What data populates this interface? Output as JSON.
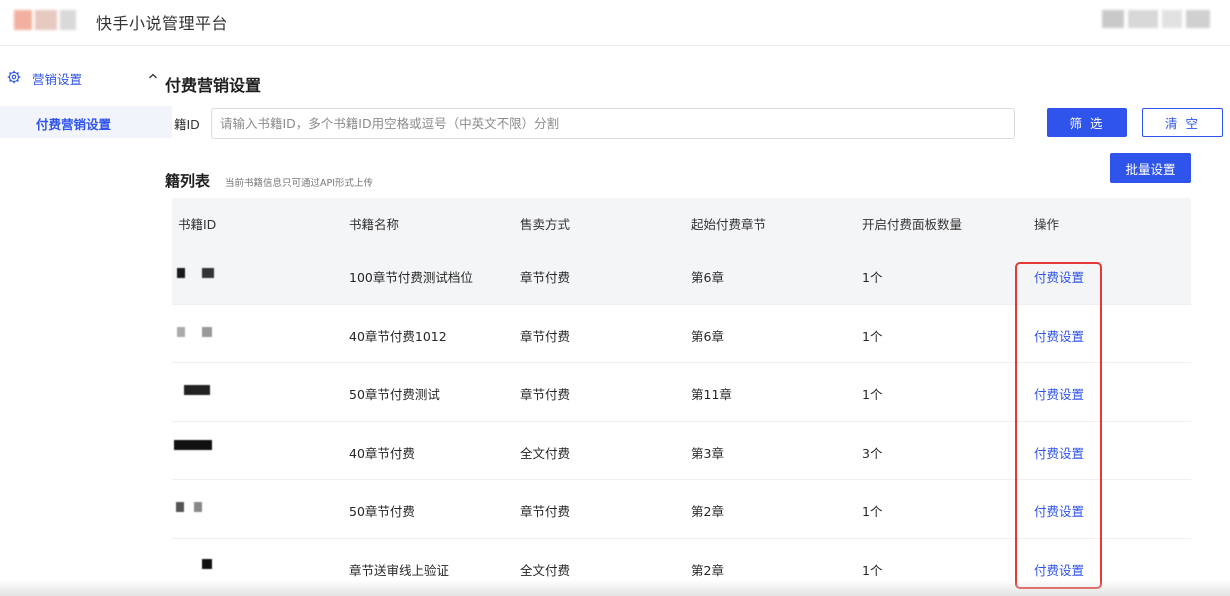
{
  "header": {
    "app_title": "快手小说管理平台",
    "logo_colors": [
      "#f3b0a0",
      "#e8c9c0",
      "#d9d9d9"
    ]
  },
  "sidebar": {
    "group": {
      "label": "营销设置",
      "icon": "gear-icon",
      "expanded": true
    },
    "items": [
      {
        "label": "付费营销设置",
        "active": true
      }
    ]
  },
  "main": {
    "page_title": "付费营销设置",
    "filter": {
      "label": "籍ID",
      "placeholder": "请输入书籍ID，多个书籍ID用空格或逗号（中英文不限）分割",
      "value": ""
    },
    "buttons": {
      "filter": "筛 选",
      "clear": "清 空",
      "batch": "批量设置"
    },
    "list_title": "籍列表",
    "list_subtitle": "当前书籍信息只可通过API形式上传"
  },
  "table": {
    "columns": [
      "书籍ID",
      "书籍名称",
      "售卖方式",
      "起始付费章节",
      "开启付费面板数量",
      "操作"
    ],
    "rows": [
      {
        "book_id": "(blurred)",
        "name": "100章节付费测试档位",
        "sale_mode": "章节付费",
        "start_chapter": "第6章",
        "panel_count": "1个",
        "action": "付费设置"
      },
      {
        "book_id": "(blurred)",
        "name": "40章节付费1012",
        "sale_mode": "章节付费",
        "start_chapter": "第6章",
        "panel_count": "1个",
        "action": "付费设置"
      },
      {
        "book_id": "(blurred)",
        "name": "50章节付费测试",
        "sale_mode": "章节付费",
        "start_chapter": "第11章",
        "panel_count": "1个",
        "action": "付费设置"
      },
      {
        "book_id": "(blurred)",
        "name": "40章节付费",
        "sale_mode": "全文付费",
        "start_chapter": "第3章",
        "panel_count": "3个",
        "action": "付费设置"
      },
      {
        "book_id": "(blurred)",
        "name": "50章节付费",
        "sale_mode": "章节付费",
        "start_chapter": "第2章",
        "panel_count": "1个",
        "action": "付费设置"
      },
      {
        "book_id": "(blurred)",
        "name": "章节送审线上验证",
        "sale_mode": "全文付费",
        "start_chapter": "第2章",
        "panel_count": "1个",
        "action": "付费设置"
      }
    ]
  },
  "colors": {
    "accent": "#2f54eb",
    "highlight_box": "#e53935",
    "header_bg": "#f4f5f7",
    "active_menu_bg": "#f2f4fb"
  }
}
